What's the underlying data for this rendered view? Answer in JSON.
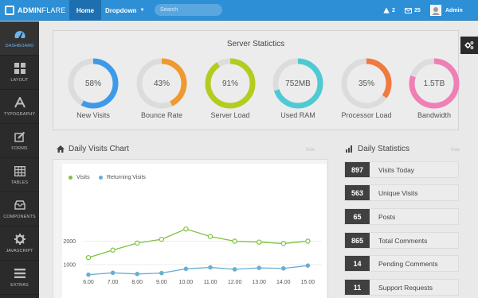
{
  "brand": {
    "name_bold": "ADMIN",
    "name_light": "FLARE"
  },
  "nav": {
    "home": "Home",
    "dropdown": "Dropdown"
  },
  "search": {
    "placeholder": "Search"
  },
  "header": {
    "alerts_count": "2",
    "mail_count": "25",
    "user_name": "Admin"
  },
  "sidebar": {
    "items": [
      {
        "label": "DASHBOARD",
        "icon": "dashboard-icon",
        "active": true
      },
      {
        "label": "LAYOUT",
        "icon": "layout-icon"
      },
      {
        "label": "TYPOGRAPHY",
        "icon": "typography-icon"
      },
      {
        "label": "FORMS",
        "icon": "forms-icon"
      },
      {
        "label": "TABLES",
        "icon": "tables-icon"
      },
      {
        "label": "COMPONENTS",
        "icon": "components-icon"
      },
      {
        "label": "JAVASCRIPT",
        "icon": "gear-icon"
      },
      {
        "label": "EXTRAS",
        "icon": "list-icon"
      }
    ]
  },
  "server": {
    "title": "Server Statictics",
    "gauges": [
      {
        "value": "58%",
        "label": "New Visits",
        "percent": 58,
        "color": "#3d9ae8"
      },
      {
        "value": "43%",
        "label": "Bounce Rate",
        "percent": 43,
        "color": "#ef9a2e"
      },
      {
        "value": "91%",
        "label": "Server Load",
        "percent": 91,
        "color": "#b4cc1e"
      },
      {
        "value": "752MB",
        "label": "Used RAM",
        "percent": 70,
        "color": "#4ecad3"
      },
      {
        "value": "35%",
        "label": "Processor Load",
        "percent": 35,
        "color": "#ef7a3e"
      },
      {
        "value": "1.5TB",
        "label": "Bandwidth",
        "percent": 80,
        "color": "#ef7fb4"
      }
    ]
  },
  "daily_chart": {
    "title": "Daily Visits Chart",
    "hide": "hide"
  },
  "chart_data": {
    "type": "line",
    "categories": [
      "6.00",
      "7.00",
      "8.00",
      "9.00",
      "10.00",
      "11.00",
      "12.00",
      "13.00",
      "14.00",
      "15.00"
    ],
    "series": [
      {
        "name": "Visits",
        "color": "#7dc242",
        "values": [
          1300,
          1620,
          1920,
          2080,
          2520,
          2200,
          2000,
          1960,
          1900,
          2000
        ]
      },
      {
        "name": "Returning Visits",
        "color": "#6aaed0",
        "values": [
          570,
          650,
          600,
          640,
          820,
          880,
          800,
          860,
          840,
          960
        ]
      }
    ],
    "yticks": [
      "2000",
      "1000"
    ],
    "ylim": [
      0,
      3000
    ],
    "grid": true,
    "legend": "top-left"
  },
  "daily_stats": {
    "title": "Daily Statistics",
    "hide": "hide",
    "rows": [
      {
        "value": "897",
        "label": "Visits Today"
      },
      {
        "value": "563",
        "label": "Unique Visits"
      },
      {
        "value": "65",
        "label": "Posts"
      },
      {
        "value": "865",
        "label": "Total Comments"
      },
      {
        "value": "14",
        "label": "Pending Comments"
      },
      {
        "value": "11",
        "label": "Support Requests"
      }
    ]
  }
}
